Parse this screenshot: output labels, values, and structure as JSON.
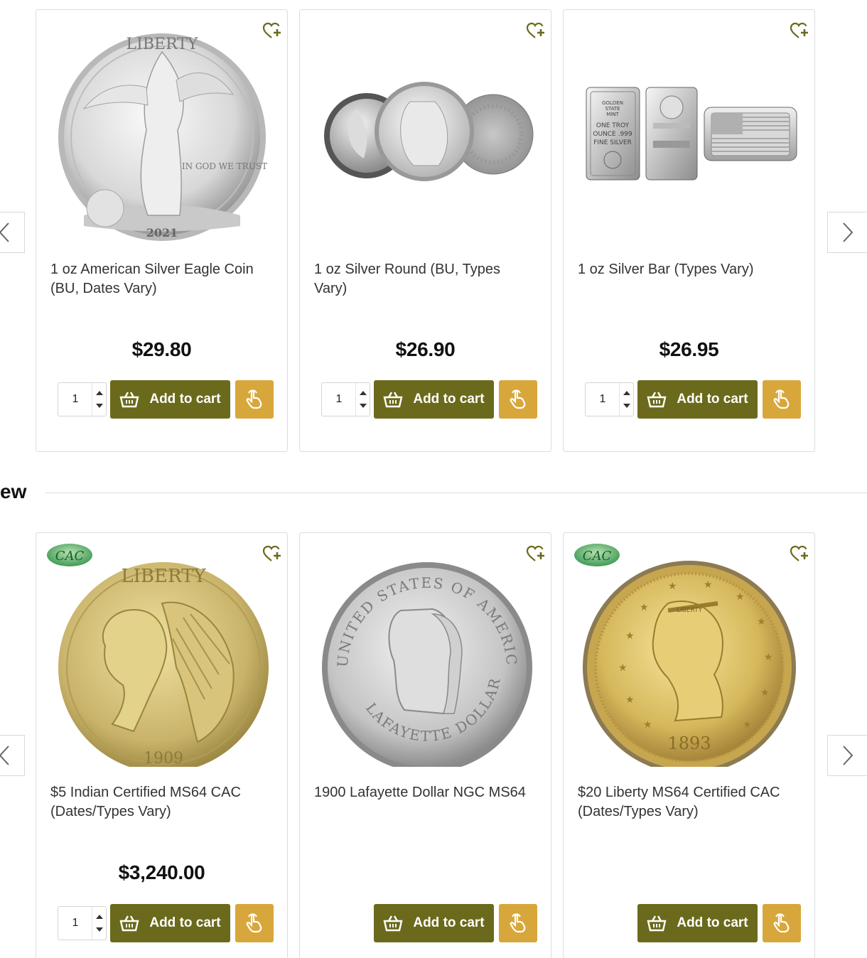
{
  "colors": {
    "cart_button": "#6b6a1c",
    "quick_buy_button": "#d8a73b",
    "wishlist_icon": "#6b6a1c",
    "border": "#dcdcdc"
  },
  "section": {
    "heading": "ew"
  },
  "row1": {
    "products": [
      {
        "title": "1 oz American Silver Eagle Coin (BU, Dates Vary)",
        "price": "$29.80",
        "quantity": "1",
        "cart_label": "Add to cart",
        "coin_year": "2021",
        "coin_text": "IN GOD WE TRUST",
        "coin_letters": "LIBERTY"
      },
      {
        "title": "1 oz Silver Round (BU, Types Vary)",
        "price": "$26.90",
        "quantity": "1",
        "cart_label": "Add to cart"
      },
      {
        "title": "1 oz Silver Bar (Types Vary)",
        "price": "$26.95",
        "quantity": "1",
        "cart_label": "Add to cart",
        "bar_text": [
          "GOLDEN",
          "STATE",
          "MINT",
          "ONE TROY",
          "OUNCE .999",
          "FINE SILVER"
        ]
      }
    ]
  },
  "row2": {
    "products": [
      {
        "title": "$5 Indian Certified MS64 CAC (Dates/Types Vary)",
        "price": "$3,240.00",
        "quantity": "1",
        "cart_label": "Add to cart",
        "badge": "CAC",
        "coin_text": "LIBERTY",
        "coin_year": "1909"
      },
      {
        "title": "1900 Lafayette Dollar NGC MS64",
        "cart_label": "Add to cart",
        "coin_text_top": "UNITED STATES OF AMERICA",
        "coin_text_bottom": "LAFAYETTE DOLLAR"
      },
      {
        "title": "$20 Liberty MS64 Certified CAC (Dates/Types Vary)",
        "cart_label": "Add to cart",
        "badge": "CAC",
        "coin_text": "LIBERTY",
        "coin_year": "1893"
      }
    ]
  }
}
